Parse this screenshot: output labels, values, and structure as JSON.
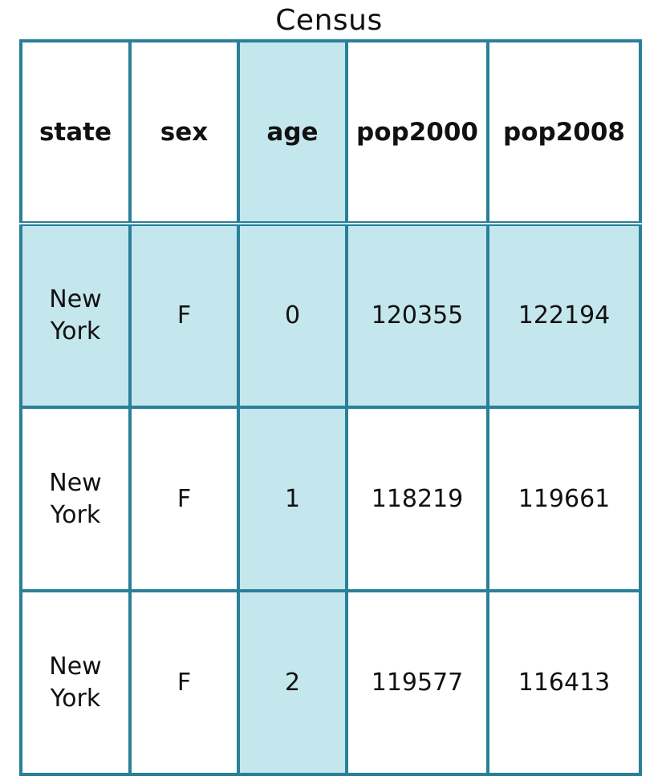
{
  "title": "Census",
  "table": {
    "headers": [
      "state",
      "sex",
      "age",
      "pop2000",
      "pop2008"
    ],
    "rows": [
      [
        "New York",
        "F",
        "0",
        "120355",
        "122194"
      ],
      [
        "New York",
        "F",
        "1",
        "118219",
        "119661"
      ],
      [
        "New York",
        "F",
        "2",
        "119577",
        "116413"
      ]
    ],
    "highlighted_column": "age",
    "highlighted_row": 0
  },
  "colors": {
    "border": "#2a8098",
    "highlight": "#c4e6ed",
    "background": "#ffffff",
    "text": "#111111"
  }
}
